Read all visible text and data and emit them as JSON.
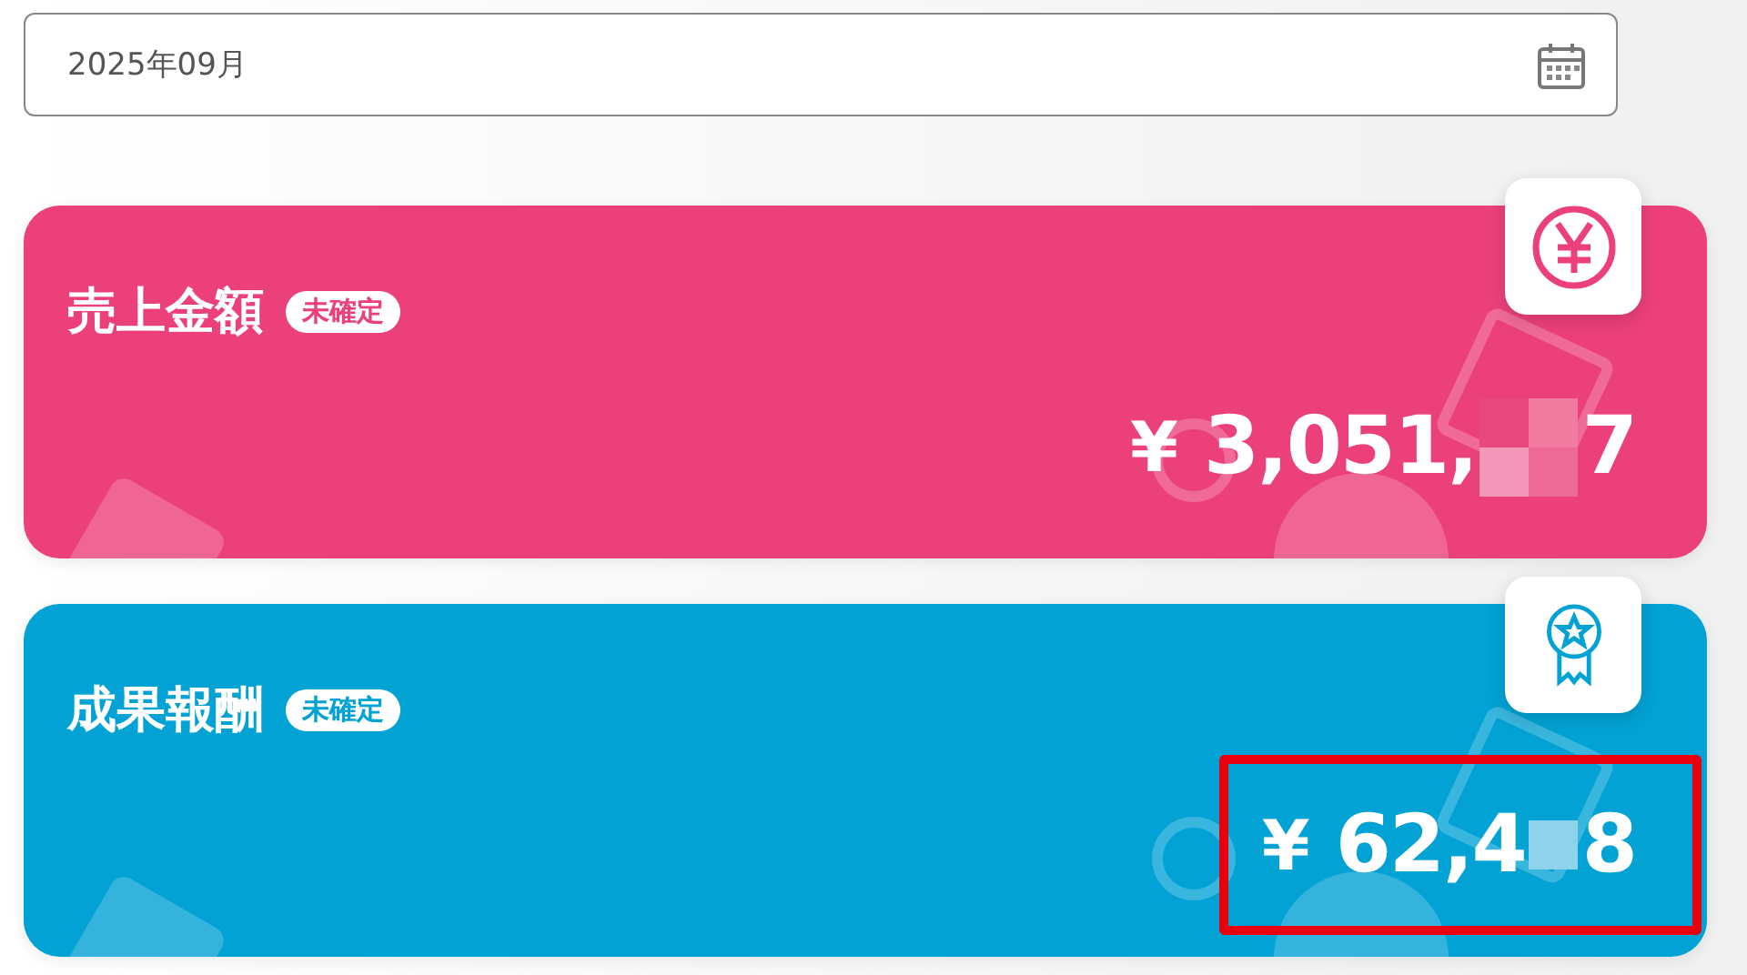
{
  "month_field": {
    "value": "2025年09月"
  },
  "cards": [
    {
      "kind": "sales",
      "title": "売上金額",
      "badge": "未確定",
      "color": "#ec407a",
      "currency": "¥",
      "amount_start": "3,051,",
      "amount_end": "7",
      "mask_tiles": [
        {
          "color": "#e8487e"
        },
        {
          "color": "#f07aa0"
        },
        {
          "color": "#f398b8"
        },
        {
          "color": "#ee6a96"
        }
      ],
      "highlighted": false
    },
    {
      "kind": "reward",
      "title": "成果報酬",
      "badge": "未確定",
      "color": "#02a2d4",
      "currency": "¥",
      "amount_start": "62,4",
      "amount_end": "8",
      "mask_tiles": [
        {
          "color": "#8fd2ec"
        }
      ],
      "highlighted": true
    }
  ]
}
